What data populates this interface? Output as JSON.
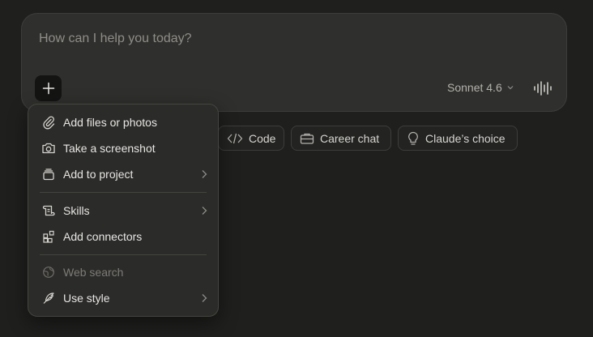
{
  "composer": {
    "placeholder": "How can I help you today?",
    "model_label": "Sonnet 4.6"
  },
  "suggestions": [
    {
      "label": "Code",
      "icon": "code-icon"
    },
    {
      "label": "Career chat",
      "icon": "briefcase-icon"
    },
    {
      "label": "Claude’s choice",
      "icon": "lightbulb-icon"
    }
  ],
  "menu": {
    "items": [
      {
        "label": "Add files or photos",
        "icon": "paperclip-icon",
        "has_submenu": false,
        "disabled": false
      },
      {
        "label": "Take a screenshot",
        "icon": "camera-icon",
        "has_submenu": false,
        "disabled": false
      },
      {
        "label": "Add to project",
        "icon": "project-icon",
        "has_submenu": true,
        "disabled": false
      },
      {
        "label": "Skills",
        "icon": "scroll-icon",
        "has_submenu": true,
        "disabled": false
      },
      {
        "label": "Add connectors",
        "icon": "connectors-icon",
        "has_submenu": false,
        "disabled": false
      },
      {
        "label": "Web search",
        "icon": "globe-icon",
        "has_submenu": false,
        "disabled": true
      },
      {
        "label": "Use style",
        "icon": "feather-icon",
        "has_submenu": true,
        "disabled": false
      }
    ]
  },
  "colors": {
    "background": "#1f1f1e",
    "composer": "#2f2f2d",
    "menu": "#2b2b29",
    "text": "#e8e6e3",
    "muted": "#8f8d88"
  }
}
